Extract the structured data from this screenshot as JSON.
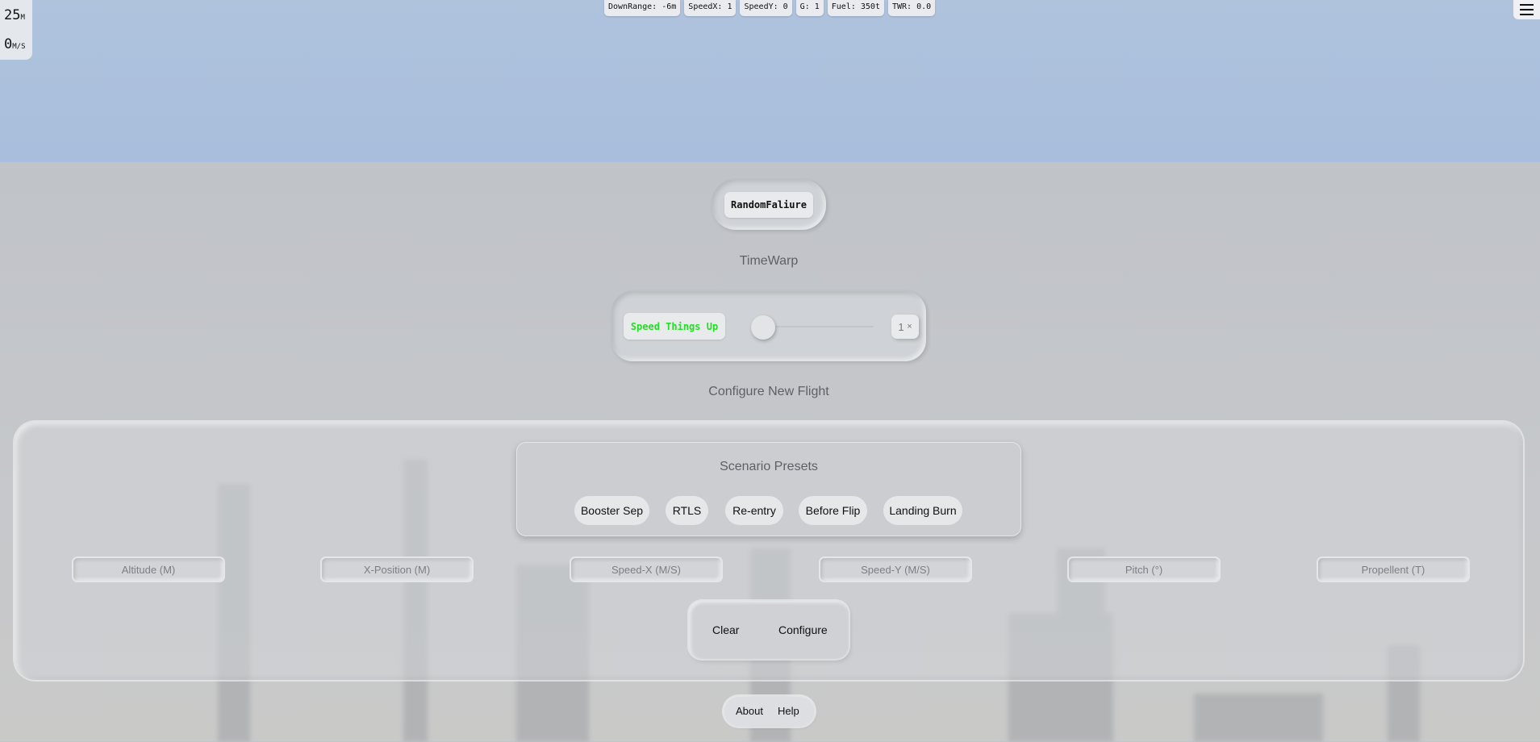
{
  "hud": {
    "altitude_value": "25",
    "altitude_unit": "M",
    "speed_value": "0",
    "speed_unit": "M/S"
  },
  "stats": {
    "downrange": "DownRange: -6m",
    "speed_x": "SpeedX: 1",
    "speed_y": "SpeedY: 0",
    "g": "G: 1",
    "fuel": "Fuel: 350t",
    "twr": "TWR: 0.0"
  },
  "failure": {
    "button_label": "RandomFaliure"
  },
  "timewarp": {
    "heading": "TimeWarp",
    "button_label": "Speed Things Up",
    "value": "1",
    "multiplier_symbol": "×",
    "slider_level": 0
  },
  "configure": {
    "heading": "Configure New Flight",
    "presets_heading": "Scenario Presets",
    "presets": [
      "Booster Sep",
      "RTLS",
      "Re-entry",
      "Before Flip",
      "Landing Burn"
    ],
    "fields": {
      "altitude": "Altitude (M)",
      "x_position": "X-Position (M)",
      "speed_x": "Speed-X (M/S)",
      "speed_y": "Speed-Y (M/S)",
      "pitch": "Pitch (°)",
      "propellent": "Propellent (T)"
    },
    "clear_label": "Clear",
    "configure_label": "Configure"
  },
  "footer": {
    "about_label": "About",
    "help_label": "Help"
  },
  "colors": {
    "speed_button_text": "#22e022",
    "sky": "#a8bedc",
    "panel": "#cfd2d6"
  }
}
